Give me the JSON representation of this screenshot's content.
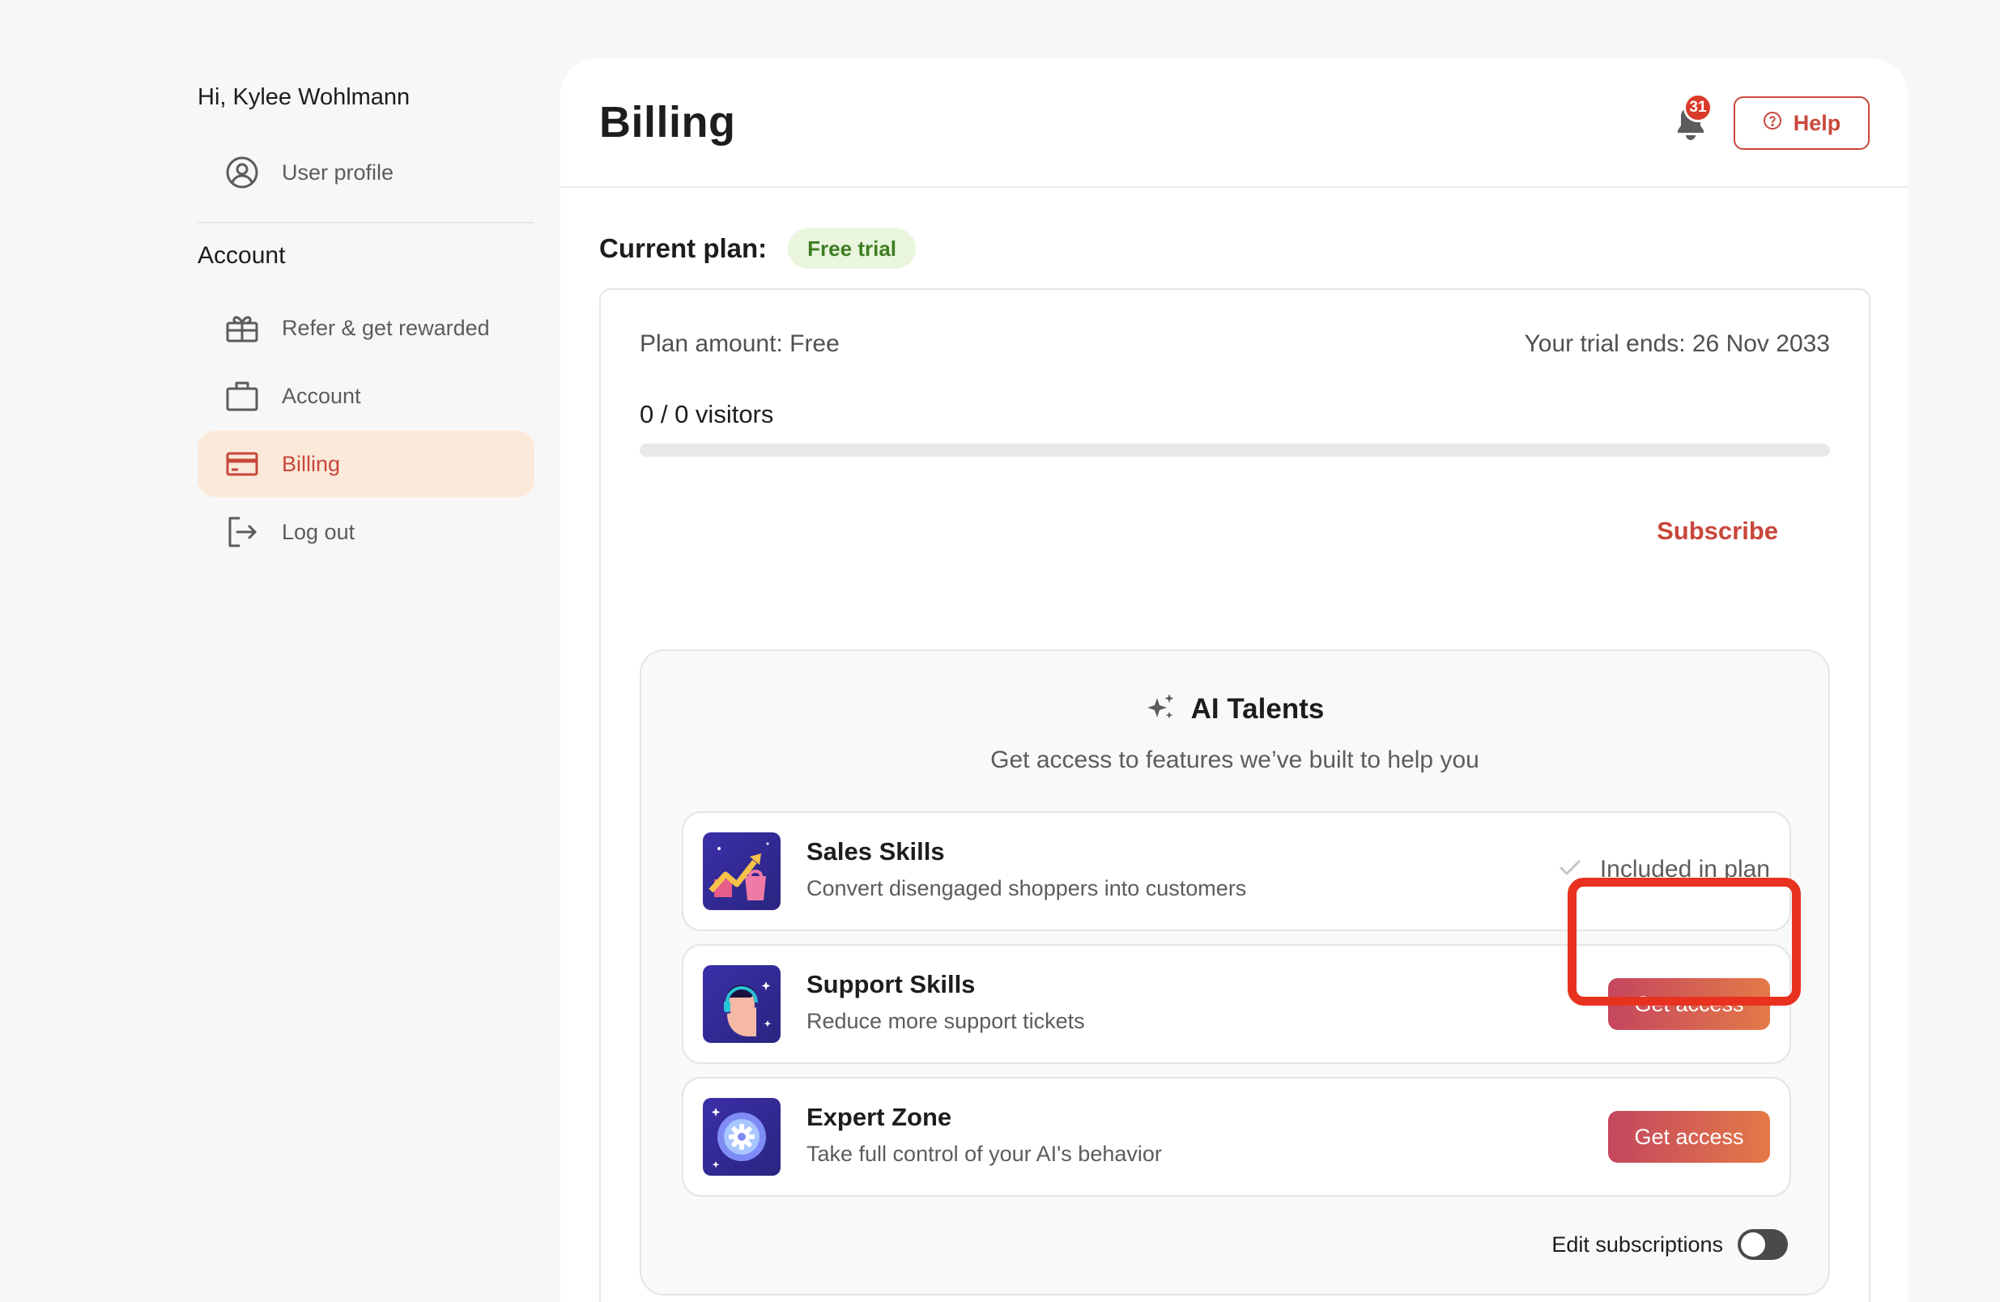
{
  "sidebar": {
    "greeting": "Hi, Kylee Wohlmann",
    "profile_item": {
      "label": "User profile",
      "icon": "user-circle-icon"
    },
    "section_title": "Account",
    "items": [
      {
        "label": "Refer & get rewarded",
        "icon": "gift-icon"
      },
      {
        "label": "Account",
        "icon": "briefcase-icon"
      },
      {
        "label": "Billing",
        "icon": "credit-card-icon",
        "active": true
      },
      {
        "label": "Log out",
        "icon": "logout-icon"
      }
    ]
  },
  "header": {
    "title": "Billing",
    "notification_count": "31",
    "help_label": "Help"
  },
  "plan": {
    "current_label": "Current plan:",
    "badge": "Free trial",
    "amount": "Plan amount: Free",
    "trial_ends": "Your trial ends: 26 Nov 2033",
    "visitors": "0 / 0 visitors",
    "usage_fraction": 0,
    "subscribe_label": "Subscribe"
  },
  "talents": {
    "title": "AI Talents",
    "subtitle": "Get access to features we’ve built to help you",
    "skills": [
      {
        "name": "Sales Skills",
        "desc": "Convert disengaged shoppers into customers",
        "status": "Included in plan"
      },
      {
        "name": "Support Skills",
        "desc": "Reduce more support tickets",
        "action": "Get access"
      },
      {
        "name": "Expert Zone",
        "desc": "Take full control of your AI's behavior",
        "action": "Get access"
      }
    ],
    "edit_label": "Edit subscriptions",
    "edit_enabled": false
  },
  "colors": {
    "accent": "#c8473b",
    "active_bg": "#fbe9da",
    "badge_bg": "#e9f5dd",
    "badge_text": "#3e7d22",
    "highlight": "#e8321f"
  }
}
